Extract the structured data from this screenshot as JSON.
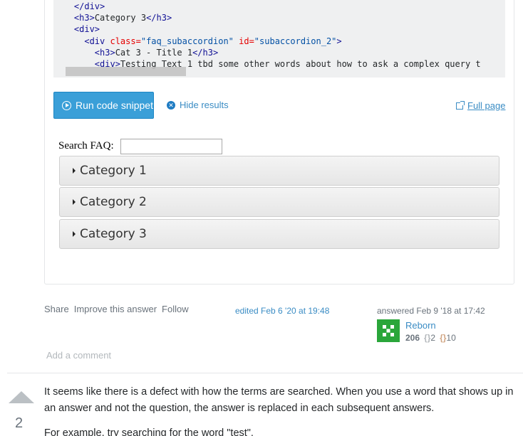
{
  "code": {
    "lines": [
      [
        {
          "t": "    ",
          "c": "plain"
        },
        {
          "t": "</div>",
          "c": "tag"
        }
      ],
      [
        {
          "t": "    ",
          "c": "plain"
        },
        {
          "t": "<h3>",
          "c": "tag"
        },
        {
          "t": "Category 3",
          "c": "plain"
        },
        {
          "t": "</h3>",
          "c": "tag"
        }
      ],
      [
        {
          "t": "    ",
          "c": "plain"
        },
        {
          "t": "<div>",
          "c": "tag"
        }
      ],
      [
        {
          "t": "      ",
          "c": "plain"
        },
        {
          "t": "<div ",
          "c": "tag"
        },
        {
          "t": "class=",
          "c": "attr"
        },
        {
          "t": "\"faq_subaccordion\"",
          "c": "str"
        },
        {
          "t": " id=",
          "c": "attr"
        },
        {
          "t": "\"subaccordion_2\"",
          "c": "str"
        },
        {
          "t": ">",
          "c": "tag"
        }
      ],
      [
        {
          "t": "        ",
          "c": "plain"
        },
        {
          "t": "<h3>",
          "c": "tag"
        },
        {
          "t": "Cat 3 - Title 1",
          "c": "plain"
        },
        {
          "t": "</h3>",
          "c": "tag"
        }
      ],
      [
        {
          "t": "        ",
          "c": "plain"
        },
        {
          "t": "<div>",
          "c": "tag"
        },
        {
          "t": "Testing Text 1 tbd some other words about how to ask a complex query t",
          "c": "plain"
        }
      ]
    ]
  },
  "snippet": {
    "run_label": "Run code snippet",
    "hide_label": "Hide results",
    "full_page_label": "Full page"
  },
  "result": {
    "search_label": "Search FAQ:",
    "search_value": "",
    "categories": [
      "Category 1",
      "Category 2",
      "Category 3"
    ]
  },
  "post_menu": {
    "share": "Share",
    "improve": "Improve this answer",
    "follow": "Follow"
  },
  "edited": "edited Feb 6 '20 at 19:48",
  "answered": "answered Feb 9 '18 at 17:42",
  "user": {
    "name": "Reborn",
    "reputation": "206",
    "silver_badge": "2",
    "bronze_badge": "10"
  },
  "add_comment": "Add a comment",
  "next_answer": {
    "votes": "2",
    "paragraphs": [
      "It seems like there is a defect with how the terms are searched. When you use a word that shows up in an answer and not the question, the answer is replaced in each subsequent answers.",
      "For example, try searching for the word \"test\"."
    ]
  }
}
